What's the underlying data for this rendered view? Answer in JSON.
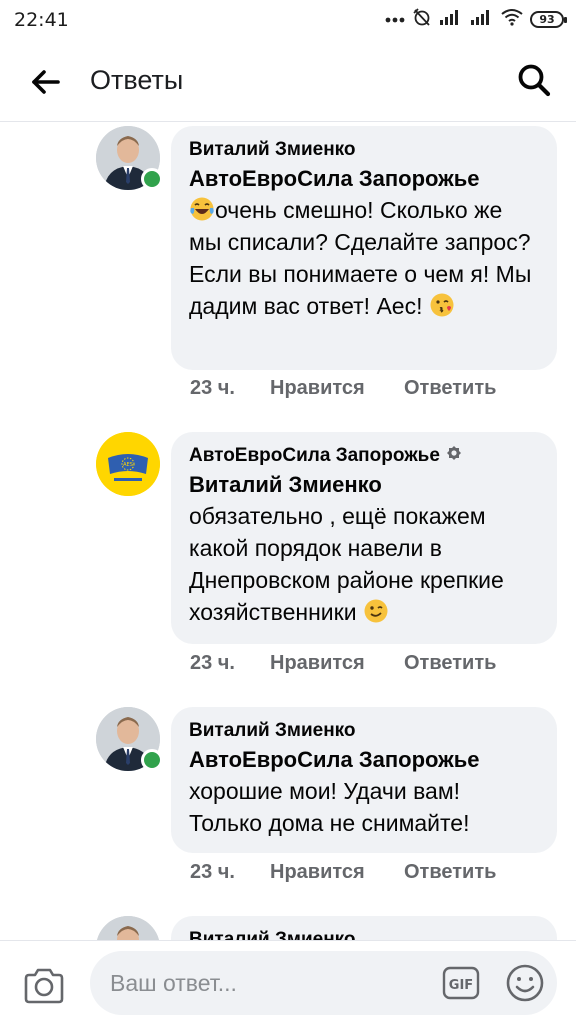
{
  "status_bar": {
    "time": "22:41",
    "battery": "93"
  },
  "app_bar": {
    "title": "Ответы"
  },
  "comments": [
    {
      "author": "Виталий Змиенко",
      "reply_to": "АвтоЕвроСила Запорожье",
      "text": "очень смешно! Сколько же мы списали? Сделайте запрос? Если вы понимаете о чем я! Мы дадим вас ответ! Аес!",
      "time": "23 ч.",
      "like_label": "Нравится",
      "reply_label": "Ответить"
    },
    {
      "author": "АвтоЕвроСила Запорожье",
      "reply_to": "Виталий Змиенко",
      "text": "обязательно , ещё покажем какой порядок навели в Днепровском районе крепкие хозяйственники",
      "time": "23 ч.",
      "like_label": "Нравится",
      "reply_label": "Ответить"
    },
    {
      "author": "Виталий Змиенко",
      "reply_to": "АвтоЕвроСила Запорожье",
      "text": "хорошие мои! Удачи вам! Только дома не снимайте!",
      "time": "23 ч.",
      "like_label": "Нравится",
      "reply_label": "Ответить"
    },
    {
      "author": "Виталий Змиенко"
    }
  ],
  "composer": {
    "placeholder": "Ваш ответ..."
  },
  "colors": {
    "bubble": "#f0f2f5",
    "meta_text": "#65676b",
    "online": "#31a24c",
    "page_badge": "#ffd600"
  }
}
